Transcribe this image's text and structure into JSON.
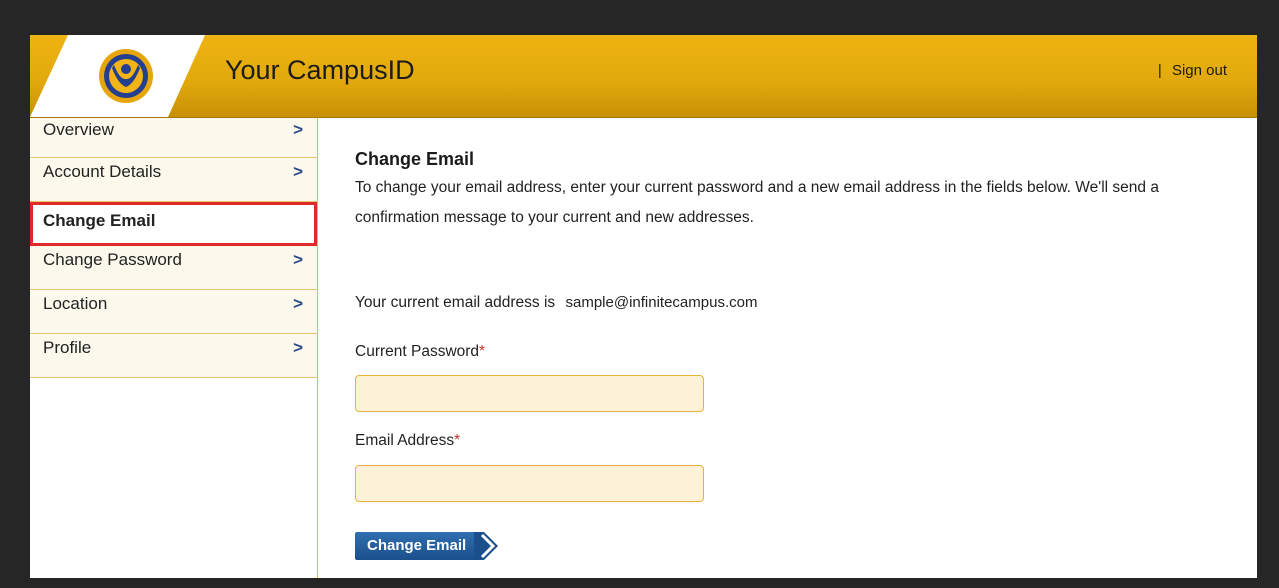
{
  "header": {
    "title": "Your CampusID",
    "separator": "|",
    "signout_label": "Sign out",
    "logo_icon": "campus-person-logo",
    "accent_color": "#efb411"
  },
  "sidebar": {
    "items": [
      {
        "label": "Overview",
        "chevron": ">"
      },
      {
        "label": "Account Details",
        "chevron": ">"
      },
      {
        "label": "Change Email",
        "chevron": ""
      },
      {
        "label": "Change Password",
        "chevron": ">"
      },
      {
        "label": "Location",
        "chevron": ">"
      },
      {
        "label": "Profile",
        "chevron": ">"
      }
    ],
    "highlight_color": "#e02a2a"
  },
  "main": {
    "title": "Change Email",
    "description": "To change your email address, enter your current password and a new email address in the fields below. We'll send a confirmation message to your current and new addresses.",
    "current_email_prefix": "Your current email address is",
    "current_email": "sample@infinitecampus.com",
    "password_label": "Current Password",
    "email_label": "Email Address",
    "required_marker": "*",
    "password_value": "",
    "email_value": "",
    "submit_label": "Change Email",
    "button_color": "#1b4f8c"
  }
}
